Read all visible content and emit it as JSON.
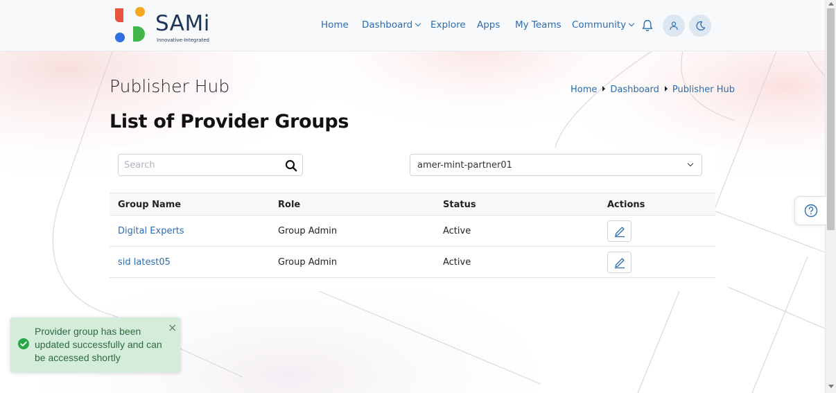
{
  "brand": {
    "name": "SAMi",
    "tagline": "Innovative-Integrated",
    "logo_colors": [
      "#e8533f",
      "#f5a623",
      "#2f6fe0",
      "#43b549"
    ]
  },
  "nav": {
    "home": "Home",
    "dashboard": "Dashboard",
    "explore": "Explore",
    "apps": "Apps",
    "my_teams": "My Teams",
    "community": "Community",
    "icons": [
      "bell-icon",
      "user-icon",
      "moon-icon"
    ]
  },
  "page": {
    "title": "Publisher Hub",
    "section_title": "List of Provider Groups"
  },
  "breadcrumb": {
    "items": [
      "Home",
      "Dashboard",
      "Publisher Hub"
    ]
  },
  "filters": {
    "search_placeholder": "Search",
    "search_value": "",
    "selected_publisher": "amer-mint-partner01"
  },
  "table": {
    "headers": [
      "Group Name",
      "Role",
      "Status",
      "Actions"
    ],
    "rows": [
      {
        "group_name": "Digital Experts",
        "role": "Group Admin",
        "status": "Active"
      },
      {
        "group_name": "sid latest05",
        "role": "Group Admin",
        "status": "Active"
      }
    ]
  },
  "toast": {
    "message": "Provider group has been updated successfully and can be accessed shortly",
    "close": "×",
    "type": "success"
  },
  "colors": {
    "accent": "#2b6cb0",
    "toast_bg": "#d4edda",
    "toast_text": "#2d6a3e",
    "success_icon": "#28a745"
  }
}
